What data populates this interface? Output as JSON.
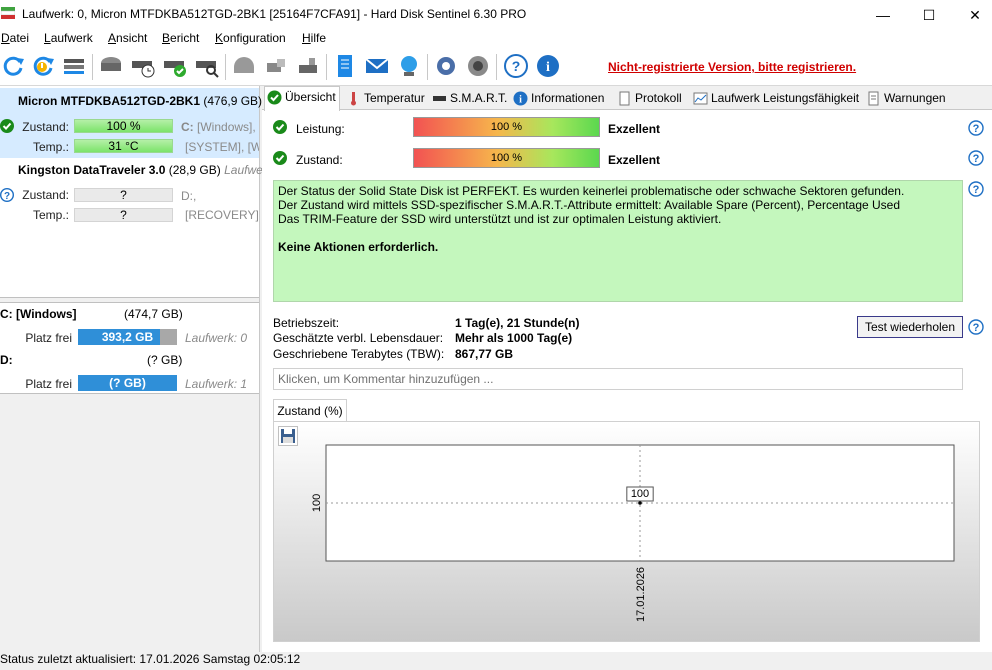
{
  "window": {
    "title": "Laufwerk: 0, Micron MTFDKBA512TGD-2BK1 [25164F7CFA91]  -  Hard Disk Sentinel 6.30 PRO",
    "minimize": "—",
    "maximize": "☐",
    "close": "✕"
  },
  "menu": [
    "Datei",
    "Laufwerk",
    "Ansicht",
    "Bericht",
    "Konfiguration",
    "Hilfe"
  ],
  "toolbar": {
    "icons": [
      "refresh-icon",
      "refresh-warning-icon",
      "disk-list-icon",
      "hdd-icon",
      "hdd-clock-icon",
      "hdd-check-icon",
      "hdd-search-icon",
      "disk-head-icon",
      "usb-icon",
      "hdd-small-icon",
      "report-icon",
      "mail-icon",
      "network-icon",
      "settings-icon",
      "sound-icon",
      "help-icon",
      "info-icon"
    ],
    "unregistered": "Nicht-registrierte Version, bitte registrieren."
  },
  "disks": [
    {
      "name": "Micron MTFDKBA512TGD-2BK1",
      "size": "(476,9 GB)",
      "health_label": "Zustand:",
      "health": "100 %",
      "temp_label": "Temp.:",
      "temp": "31 °C",
      "vol_letter": "C:",
      "vol_name": "[Windows],",
      "vol_extra": "[SYSTEM],  [W"
    },
    {
      "name": "Kingston DataTraveler 3.0",
      "size": "(28,9 GB)",
      "extra": "Laufwe",
      "health_label": "Zustand:",
      "health": "?",
      "temp_label": "Temp.:",
      "temp": "?",
      "vol_letter": "D:,",
      "vol_extra": "[RECOVERY]"
    }
  ],
  "partitions": [
    {
      "name": "C: [Windows]",
      "size": "(474,7 GB)",
      "free_label": "Platz frei",
      "free": "393,2 GB",
      "free_fraction": 0.83,
      "drive": "Laufwerk: 0"
    },
    {
      "name": "D:",
      "size": "(? GB)",
      "free_label": "Platz frei",
      "free": "(? GB)",
      "free_fraction": 1.0,
      "drive": "Laufwerk: 1"
    }
  ],
  "tabs": [
    "Übersicht",
    "Temperatur",
    "S.M.A.R.T.",
    "Informationen",
    "Protokoll",
    "Laufwerk Leistungsfähigkeit",
    "Warnungen"
  ],
  "overview": {
    "perf_label": "Leistung:",
    "perf_value": "100 %",
    "perf_text": "Exzellent",
    "health_label": "Zustand:",
    "health_value": "100 %",
    "health_text": "Exzellent",
    "status_lines": [
      "Der Status der Solid State Disk ist PERFEKT. Es wurden keinerlei problematische oder schwache Sektoren gefunden.",
      "Der Zustand wird mittels SSD-spezifischer S.M.A.R.T.-Attribute ermittelt:  Available Spare (Percent), Percentage Used",
      "Das TRIM-Feature der SSD wird unterstützt und ist zur optimalen Leistung aktiviert."
    ],
    "action": "Keine Aktionen erforderlich.",
    "uptime_label": "Betriebszeit:",
    "uptime": "1 Tag(e), 21 Stunde(n)",
    "life_label": "Geschätzte verbl. Lebensdauer:",
    "life": "Mehr als 1000 Tag(e)",
    "tbw_label": "Geschriebene Terabytes (TBW):",
    "tbw": "867,77 GB",
    "retest": "Test wiederholen",
    "comment_placeholder": "Klicken, um Kommentar hinzuzufügen ..."
  },
  "chart_tab": "Zustand (%)",
  "chart_data": {
    "type": "line",
    "x": [
      "17.01.2026"
    ],
    "series": [
      {
        "values": [
          100
        ]
      }
    ],
    "y_tick_labels": [
      "100"
    ],
    "data_labels": [
      "100"
    ],
    "grid": true
  },
  "status": "Status zuletzt aktualisiert: 17.01.2026 Samstag 02:05:12",
  "colors": {
    "accent": "#2f8fd8",
    "ok": "#7ce36a",
    "warning_text": "#d00000",
    "status_bg": "#c4f7bd"
  }
}
